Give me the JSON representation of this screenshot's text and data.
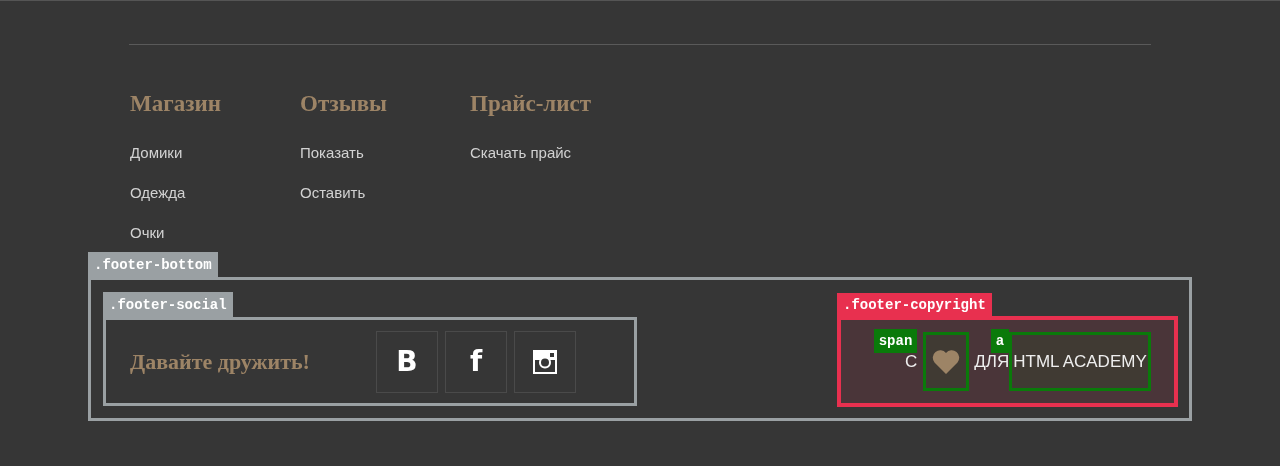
{
  "nav_columns": [
    {
      "heading": "Магазин",
      "links": [
        "Домики",
        "Одежда",
        "Очки"
      ]
    },
    {
      "heading": "Отзывы",
      "links": [
        "Показать",
        "Оставить"
      ]
    },
    {
      "heading": "Прайс-лист",
      "links": [
        "Скачать прайс"
      ]
    }
  ],
  "footer_bottom": {
    "overlay_label": ".footer-bottom",
    "social": {
      "overlay_label": ".footer-social",
      "title": "Давайте дружить!",
      "buttons": [
        {
          "kind": "text",
          "glyph": "В"
        },
        {
          "kind": "text",
          "glyph": "f"
        },
        {
          "kind": "icon"
        }
      ]
    },
    "copyright": {
      "overlay_label": ".footer-copyright",
      "prefix": "С",
      "span_label": "span",
      "middle": "ДЛЯ",
      "a_label": "a",
      "link": "HTML ACADEMY"
    }
  }
}
